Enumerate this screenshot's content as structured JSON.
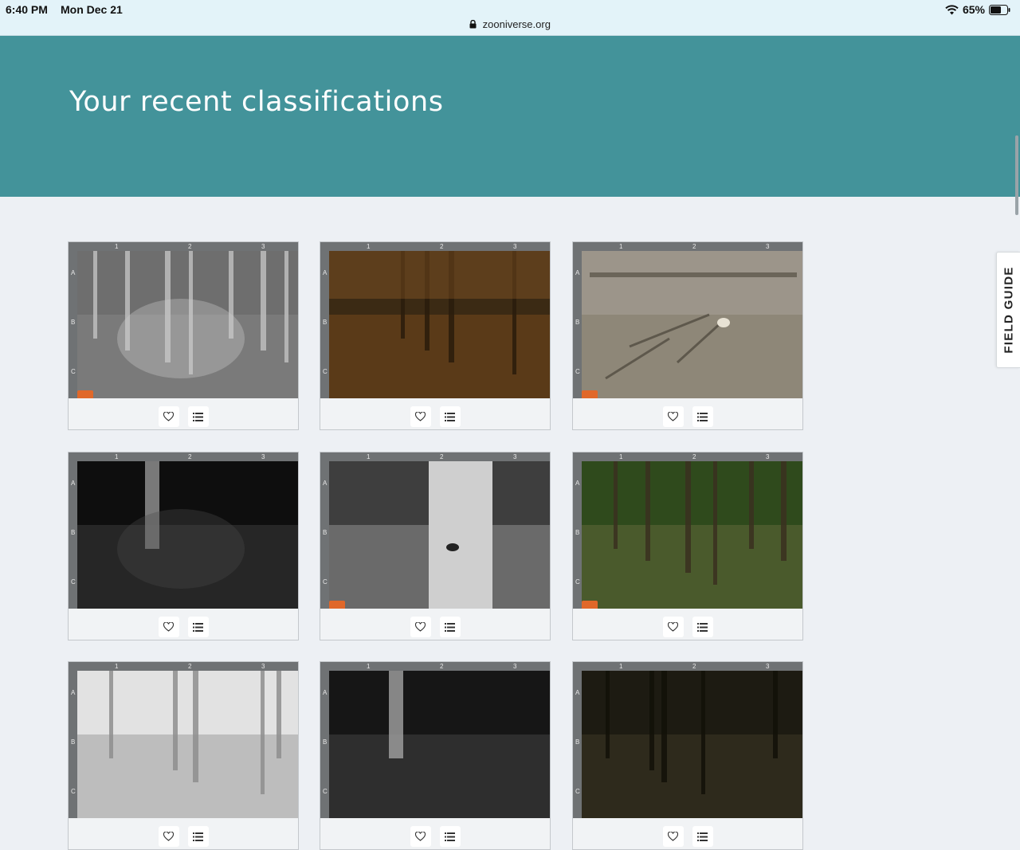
{
  "status": {
    "time": "6:40 PM",
    "date": "Mon Dec 21",
    "battery": "65%",
    "url": "zooniverse.org"
  },
  "page": {
    "title": "Your recent classifications",
    "field_guide_label": "FIELD GUIDE"
  },
  "ruler": {
    "columns": [
      "1",
      "2",
      "3"
    ],
    "rows": [
      "A",
      "B",
      "C"
    ]
  },
  "classifications": [
    {
      "scene": "night-grey-brush",
      "tint": "#8a8a8a",
      "badge": true
    },
    {
      "scene": "dusk-brown-forest",
      "tint": "#5a3a18",
      "badge": false
    },
    {
      "scene": "day-leaf-litter",
      "tint": "#8b8576",
      "badge": true
    },
    {
      "scene": "night-dark-forest",
      "tint": "#2b2b2b",
      "badge": false
    },
    {
      "scene": "night-tree-trunk",
      "tint": "#5c5c5c",
      "badge": true
    },
    {
      "scene": "day-green-forest",
      "tint": "#3e5426",
      "badge": true
    },
    {
      "scene": "day-bright-bw",
      "tint": "#c9c9c9",
      "badge": false
    },
    {
      "scene": "night-trunk-dark",
      "tint": "#3a3a3a",
      "badge": false
    },
    {
      "scene": "dusk-dark-forest",
      "tint": "#2e2a1c",
      "badge": false
    }
  ],
  "icons": {
    "favorite": "heart-icon",
    "collect": "list-icon"
  }
}
